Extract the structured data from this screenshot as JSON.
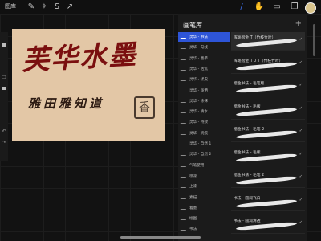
{
  "toolbar": {
    "gallery_label": "图库",
    "tools": [
      {
        "icon": "wrench-icon",
        "glyph": "✎"
      },
      {
        "icon": "magic-wand-icon",
        "glyph": "✧"
      },
      {
        "icon": "selection-icon",
        "glyph": "S"
      },
      {
        "icon": "transform-arrow-icon",
        "glyph": "↗"
      }
    ],
    "right_tools": [
      {
        "icon": "brush-icon",
        "glyph": "/"
      },
      {
        "icon": "smudge-icon",
        "glyph": "✋"
      },
      {
        "icon": "eraser-icon",
        "glyph": "▭"
      },
      {
        "icon": "layers-icon",
        "glyph": "❐"
      }
    ],
    "color_swatch": "#d9c48b",
    "accent": "#3d6ee8"
  },
  "artwork": {
    "main_text": "芙华水墨",
    "sub_text": "雅田雅知道",
    "seal_text": "香"
  },
  "brush_library": {
    "title": "画笔库",
    "add_icon": "plus-icon",
    "categories": [
      "灵华 - 书法",
      "灵华 - 勾线",
      "灵华 - 墨晕",
      "灵华 - 枯焦",
      "灵华 - 揉皮",
      "灵华 - 泼洒",
      "灵华 - 涂抹",
      "灵华 - 清水",
      "灵华 - 特效",
      "灵华 - 刷痕",
      "灵华 - 自然 1",
      "灵华 - 自然 2",
      "气笔使用",
      "喷漆",
      "上漆",
      "素描",
      "着墨",
      "绘图",
      "书法"
    ],
    "active_category": 0,
    "brushes": [
      "挥毫楷金 T（竹枝竹叶）",
      "挥毫楷金 T 0 T（竹枝竹叶）",
      "楷金书法 - 毛笔版",
      "楷金书法 - 毛版",
      "楷金书法 - 毛笔 2",
      "楷金书法 - 毛版",
      "楷金书法 - 毛笔 2",
      "书法 - 圆润飞白",
      "书法 - 圆润清透"
    ],
    "active_brush": 0
  }
}
